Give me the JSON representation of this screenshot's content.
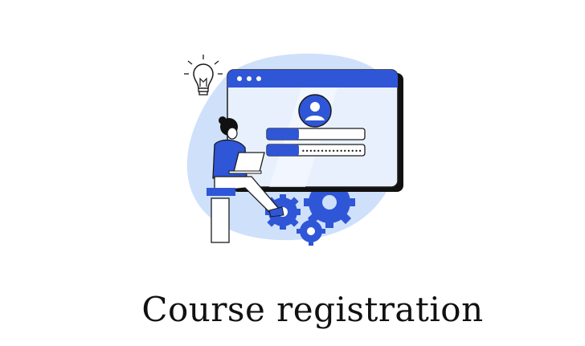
{
  "illustration": {
    "icons": [
      "lightbulb-icon",
      "browser-window-icon",
      "user-avatar-icon",
      "laptop-icon",
      "gear-icon"
    ],
    "login_form": {
      "password_mask": "••••••••••••••••"
    }
  },
  "title": "Course registration",
  "colors": {
    "accent": "#2f56d6",
    "light_blue": "#cfe0fb",
    "panel": "#e9f0fd",
    "ink": "#111111"
  }
}
